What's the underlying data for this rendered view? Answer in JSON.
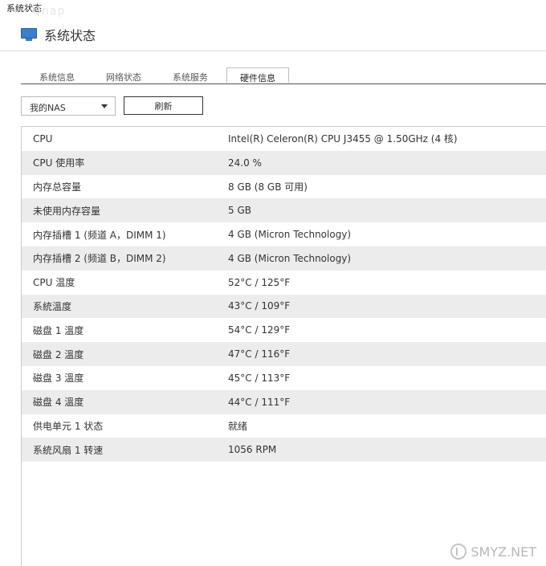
{
  "window": {
    "title": "系统状态",
    "ghost_text": "Qnap"
  },
  "header": {
    "title": "系统状态",
    "icon": "monitor-icon"
  },
  "tabs": [
    {
      "label": "系统信息",
      "active": false
    },
    {
      "label": "网络状态",
      "active": false
    },
    {
      "label": "系统服务",
      "active": false
    },
    {
      "label": "硬件信息",
      "active": true
    }
  ],
  "toolbar": {
    "device_select": "我的NAS",
    "refresh_label": "刷新"
  },
  "hardware": [
    {
      "key": "CPU",
      "value": "Intel(R) Celeron(R) CPU J3455 @ 1.50GHz (4 核)"
    },
    {
      "key": "CPU 使用率",
      "value": "24.0 %"
    },
    {
      "key": "内存总容量",
      "value": "8 GB (8 GB 可用)"
    },
    {
      "key": "未使用内存容量",
      "value": "5 GB"
    },
    {
      "key": "内存插槽 1 (频道 A，DIMM 1)",
      "value": "4 GB (Micron Technology)"
    },
    {
      "key": "内存插槽 2 (频道 B，DIMM 2)",
      "value": "4 GB (Micron Technology)"
    },
    {
      "key": "CPU 温度",
      "value": "52°C / 125°F"
    },
    {
      "key": "系統溫度",
      "value": "43°C / 109°F"
    },
    {
      "key": "磁盘 1 溫度",
      "value": "54°C / 129°F"
    },
    {
      "key": "磁盘 2 溫度",
      "value": "47°C / 116°F"
    },
    {
      "key": "磁盘 3 溫度",
      "value": "45°C / 113°F"
    },
    {
      "key": "磁盘 4 溫度",
      "value": "44°C / 111°F"
    },
    {
      "key": "供电单元 1 状态",
      "value": "就绪"
    },
    {
      "key": "系統风扇 1 转速",
      "value": "1056 RPM"
    }
  ],
  "watermark": {
    "text": "SMYZ.NET"
  }
}
